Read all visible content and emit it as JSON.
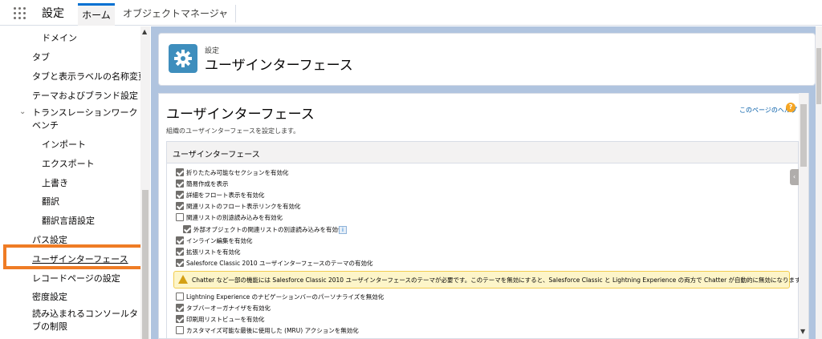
{
  "topbar": {
    "app_name": "設定",
    "tab_home": "ホーム",
    "tab_object_manager": "オブジェクトマネージャ"
  },
  "sidebar": {
    "items": [
      {
        "label": "ドメイン"
      },
      {
        "label": "タブ"
      },
      {
        "label": "タブと表示ラベルの名称変更"
      },
      {
        "label": "テーマおよびブランド設定"
      },
      {
        "label": "トランスレーションワークベンチ"
      },
      {
        "label": "インポート"
      },
      {
        "label": "エクスポート"
      },
      {
        "label": "上書き"
      },
      {
        "label": "翻訳"
      },
      {
        "label": "翻訳言語設定"
      },
      {
        "label": "パス設定"
      },
      {
        "label": "ユーザインターフェース"
      },
      {
        "label": "レコードページの設定"
      },
      {
        "label": "密度設定"
      },
      {
        "label": "読み込まれるコンソールタブの制限"
      }
    ]
  },
  "header": {
    "breadcrumb": "設定",
    "title": "ユーザインターフェース"
  },
  "content": {
    "title": "ユーザインターフェース",
    "description": "組織のユーザインターフェースを設定します。",
    "help_link": "このページのヘルプ",
    "section_title": "ユーザインターフェース",
    "options": [
      {
        "label": "折りたたみ可能なセクションを有効化",
        "checked": true
      },
      {
        "label": "簡易作成を表示",
        "checked": true
      },
      {
        "label": "詳細をフロート表示を有効化",
        "checked": true
      },
      {
        "label": "関連リストのフロート表示リンクを有効化",
        "checked": true
      },
      {
        "label": "関連リストの別途読み込みを有効化",
        "checked": false
      },
      {
        "label": "外部オブジェクトの関連リストの別途読み込みを有効化",
        "checked": true
      },
      {
        "label": "インライン編集を有効化",
        "checked": true
      },
      {
        "label": "拡張リストを有効化",
        "checked": true
      },
      {
        "label": "Salesforce Classic 2010 ユーザインターフェースのテーマの有効化",
        "checked": true
      },
      {
        "label": "Lightning Experience のナビゲーションバーのパーソナライズを無効化",
        "checked": false
      },
      {
        "label": "タブバーオーガナイザを有効化",
        "checked": true
      },
      {
        "label": "印刷用リストビューを有効化",
        "checked": true
      },
      {
        "label": "カスタマイズ可能な最後に使用した (MRU) アクションを無効化",
        "checked": false
      }
    ],
    "warning": "Chatter など一部の機能には Salesforce Classic 2010 ユーザインターフェースのテーマが必要です。このテーマを無効にすると、Salesforce Classic と Lightning Experience の両方で Chatter が自動的に無効になります。"
  },
  "colors": {
    "accent": "#0070d2",
    "highlight": "#ef7c25",
    "header_icon": "#3e8ebd",
    "main_bg": "#b0c4df"
  }
}
